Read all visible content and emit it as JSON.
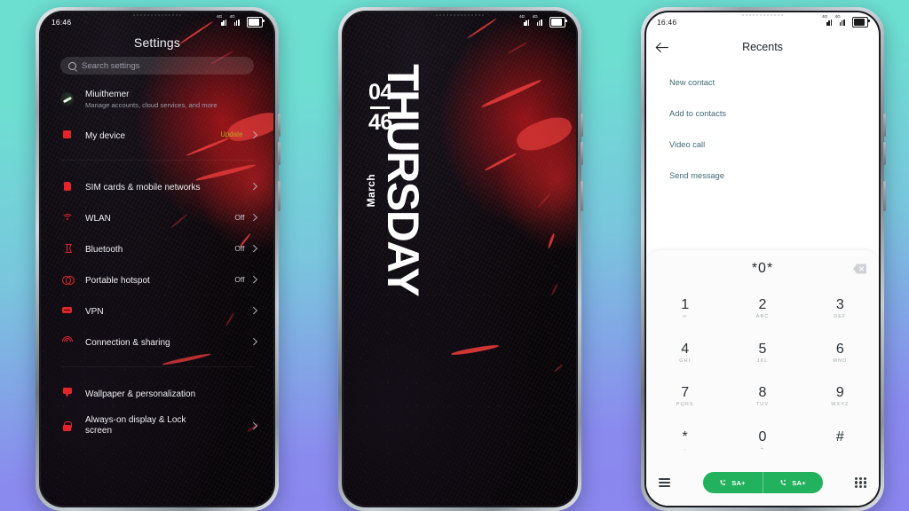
{
  "background": {
    "top_color": "#6ddfd1",
    "bottom_color": "#8b86ef"
  },
  "phone1": {
    "status": {
      "time": "16:46",
      "network1": "4G",
      "network2": "4G"
    },
    "title": "Settings",
    "search": {
      "placeholder": "Search settings",
      "icon": "search-icon"
    },
    "account": {
      "name": "Miuithemer",
      "subtitle": "Manage accounts, cloud services, and more",
      "icon": "avatar"
    },
    "items": [
      {
        "label": "My device",
        "value": "",
        "badge": "Update",
        "badge_color": "#b8a81e",
        "icon": "device-icon"
      },
      {
        "label": "SIM cards & mobile networks",
        "value": "",
        "badge": "",
        "icon": "sim-card-icon"
      },
      {
        "label": "WLAN",
        "value": "Off",
        "badge": "",
        "icon": "wifi-icon"
      },
      {
        "label": "Bluetooth",
        "value": "Off",
        "badge": "",
        "icon": "bluetooth-icon"
      },
      {
        "label": "Portable hotspot",
        "value": "Off",
        "badge": "",
        "icon": "hotspot-icon"
      },
      {
        "label": "VPN",
        "value": "",
        "badge": "",
        "icon": "vpn-icon"
      },
      {
        "label": "Connection & sharing",
        "value": "",
        "badge": "",
        "icon": "connection-sharing-icon"
      },
      {
        "label": "Wallpaper & personalization",
        "value": "",
        "badge": "",
        "icon": "wallpaper-icon"
      },
      {
        "label": "Always-on display & Lock screen",
        "value": "",
        "badge": "",
        "icon": "lock-icon"
      }
    ],
    "accent_color": "#e4242a"
  },
  "phone2": {
    "status": {
      "time": "",
      "network1": "4G",
      "network2": "4G"
    },
    "clock": {
      "hours": "04",
      "minutes": "46"
    },
    "month": "March",
    "day": "THURSDAY"
  },
  "phone3": {
    "status": {
      "time": "16:46",
      "network1": "4G",
      "network2": "4G"
    },
    "header": {
      "title": "Recents",
      "back_icon": "back-arrow-icon"
    },
    "links": [
      "New contact",
      "Add to contacts",
      "Video call",
      "Send message"
    ],
    "link_color": "#3d6a77",
    "dialer": {
      "entry": "*0*",
      "backspace_icon": "backspace-icon",
      "keys": [
        {
          "digit": "1",
          "letters": "∞"
        },
        {
          "digit": "2",
          "letters": "ABC"
        },
        {
          "digit": "3",
          "letters": "DEF"
        },
        {
          "digit": "4",
          "letters": "GHI"
        },
        {
          "digit": "5",
          "letters": "JKL"
        },
        {
          "digit": "6",
          "letters": "MNO"
        },
        {
          "digit": "7",
          "letters": "PQRS"
        },
        {
          "digit": "8",
          "letters": "TUV"
        },
        {
          "digit": "9",
          "letters": "WXYZ"
        },
        {
          "digit": "*",
          "letters": ","
        },
        {
          "digit": "0",
          "letters": "+"
        },
        {
          "digit": "#",
          "letters": ""
        }
      ],
      "call_buttons": [
        {
          "label": "SA+",
          "icon": "phone-call-icon"
        },
        {
          "label": "SA+",
          "icon": "phone-call-icon"
        }
      ],
      "call_color": "#22b15c",
      "left_icon": "menu-icon",
      "right_icon": "keypad-icon"
    }
  }
}
